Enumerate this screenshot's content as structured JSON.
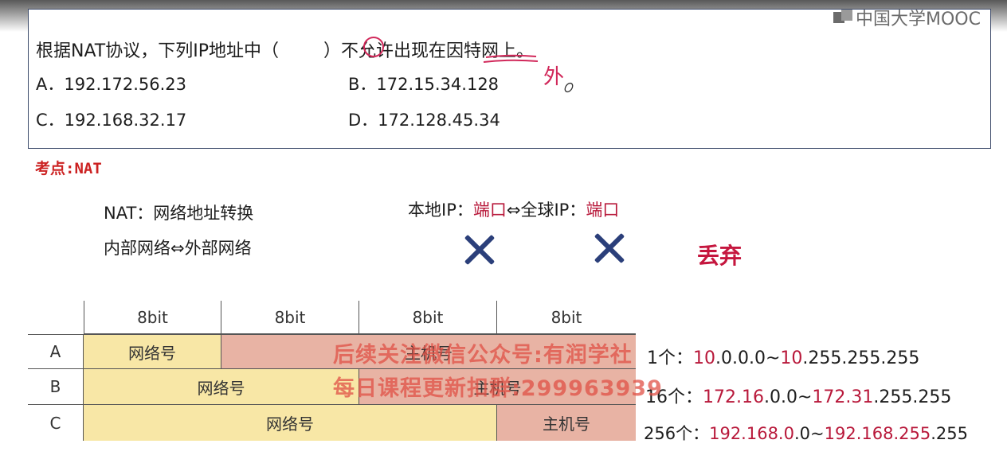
{
  "brand": {
    "logo_text": "中国大学MOOC"
  },
  "question": {
    "title": "根据NAT协议，下列IP地址中（        ）不允许出现在因特网上。",
    "annotation": "外",
    "options": {
      "A": "A．192.172.56.23",
      "B": "B．172.15.34.128",
      "C": "C．192.168.32.17",
      "D": "D．172.128.45.34"
    }
  },
  "kaodian": "考点:NAT",
  "explain": {
    "nat_def": "NAT：网络地址转换",
    "inside_outside": "内部网络⇔外部网络",
    "local_ip_label": "本地IP：",
    "port1": "端口",
    "arrow_global": "⇔全球IP：",
    "port2": "端口",
    "discard": "丢弃"
  },
  "table": {
    "headers": [
      "8bit",
      "8bit",
      "8bit",
      "8bit"
    ],
    "rows": [
      {
        "label": "A",
        "net": "网络号",
        "host": "主机号"
      },
      {
        "label": "B",
        "net": "网络号",
        "host": "主机号"
      },
      {
        "label": "C",
        "net": "网络号",
        "host": "主机号"
      }
    ]
  },
  "ranges": [
    {
      "count": "1个：",
      "s1": "10",
      "s2": ".0.0.0",
      "tilde": "~",
      "e1": "10",
      "e2": ".255.255.255"
    },
    {
      "count": "16个：",
      "s1": "172.16",
      "s2": ".0.0",
      "tilde": "~",
      "e1": "172.31",
      "e2": ".255.255"
    },
    {
      "count": "256个：",
      "s1": "192.168.0",
      "s2": ".0",
      "tilde": "~",
      "e1": "192.168.255",
      "e2": ".255"
    }
  ],
  "watermark": {
    "line1": "后续关注微信公众号:有润学社",
    "line2": "每日课程更新扣群:299963939"
  },
  "colors": {
    "accent_red": "#b8183a",
    "frame": "#3c4a6a",
    "net_fill": "#f8e7a6",
    "host_fill": "#e8b3a4"
  }
}
